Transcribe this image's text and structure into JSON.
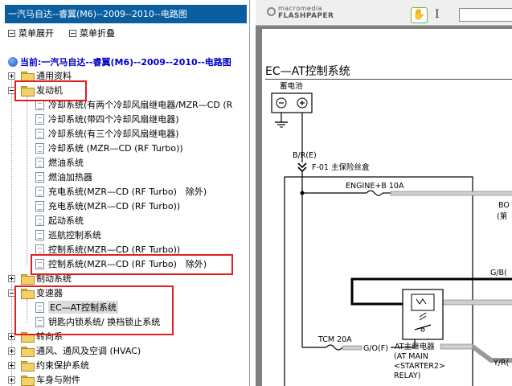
{
  "left_pane": {
    "title": "一汽马自达--睿翼(M6)--2009--2010--电路图",
    "toolbar": {
      "expand_all": "菜单展开",
      "collapse_all": "菜单折叠"
    },
    "current": "当前:一汽马自达--睿翼(M6)--2009--2010--电路图",
    "tree": {
      "general": "通用资料",
      "engine": "发动机",
      "engine_items": [
        "冷却系统(有两个冷却风扇继电器/MZR—CD (R",
        "冷却系统(带四个冷却风扇继电器)",
        "冷却系统(有三个冷却风扇继电器)",
        "冷却系统 (MZR—CD (RF Turbo))",
        "燃油系统",
        "燃油加热器",
        "充电系统(MZR—CD (RF Turbo)　除外)",
        "充电系统(MZR—CD (RF Turbo))",
        "起动系统",
        "巡航控制系统",
        "控制系统(MZR—CD (RF Turbo))",
        "控制系统(MZR—CD (RF Turbo)　除外)"
      ],
      "brake": "制动系统",
      "transmission": "变速器",
      "transmission_items": [
        "EC—AT控制系统",
        "钥匙内锁系统/ 换档锁止系统"
      ],
      "steering": "转向系",
      "hvac": "通风、通风及空调 (HVAC)",
      "restraint": "约束保护系统",
      "body": "车身与附件"
    }
  },
  "viewer": {
    "logo_top": "macromedia",
    "logo_bottom": "FLASHPAPER",
    "icons": [
      "hand-tool-icon",
      "text-select-icon"
    ],
    "page_title": "EC—AT控制系统",
    "diagram": {
      "battery": "蓄电池",
      "wire_br": "B/R(E)",
      "fuse_f01": "F-01  主保险丝盒",
      "fuse_engine": "ENGINE+B 10A",
      "label_bo": "BO",
      "label_paren": "(第",
      "wire_gb": "G/B(",
      "fuse_tcm": "TCM 20A",
      "wire_go": "G/O(F)",
      "relay_cn": "AT主继电器",
      "relay_en1": "(AT MAIN",
      "relay_en2": "<STARTER2>",
      "relay_en3": "RELAY)",
      "wire_yr": "Y/R("
    }
  },
  "colors": {
    "title_bar": "#0a5ea0",
    "highlight_box": "#e02020",
    "current_link": "#0000cc",
    "selected_bg": "#dcdcdc"
  }
}
